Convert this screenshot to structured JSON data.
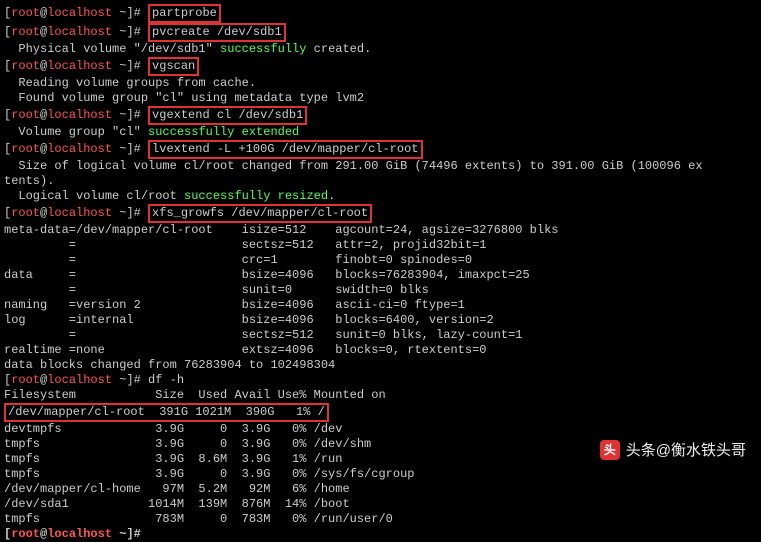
{
  "prompt": {
    "user": "root",
    "at": "@",
    "host": "localhost",
    "path": " ~",
    "hash": "]# "
  },
  "cmds": {
    "partprobe": "partprobe",
    "pvcreate": "pvcreate /dev/sdb1",
    "vgscan": "vgscan",
    "vgextend": "vgextend cl /dev/sdb1",
    "lvextend": "lvextend -L +100G /dev/mapper/cl-root",
    "xfs": "xfs_growfs /dev/mapper/cl-root",
    "dfh": "df -h"
  },
  "out": {
    "pv1": "  Physical volume \"/dev/sdb1\" ",
    "pv1_ok": "successfully",
    "pv1_end": " created.",
    "vgscan1": "  Reading volume groups from cache.",
    "vgscan2": "  Found volume group \"cl\" using metadata type lvm2",
    "vgext1a": "  Volume group \"cl\" ",
    "vgext1b": "successfully extended",
    "lvext1": "  Size of logical volume cl/root changed from 291.00 GiB (74496 extents) to 391.00 GiB (100096 ex",
    "lvext1b": "tents).",
    "lvext2a": "  Logical volume cl/root ",
    "lvext2b": "successfully resized",
    "lvext2c": ".",
    "xfs1": "meta-data=/dev/mapper/cl-root    isize=512    agcount=24, agsize=3276800 blks",
    "xfs2": "         =                       sectsz=512   attr=2, projid32bit=1",
    "xfs3": "         =                       crc=1        finobt=0 spinodes=0",
    "xfs4": "data     =                       bsize=4096   blocks=76283904, imaxpct=25",
    "xfs5": "         =                       sunit=0      swidth=0 blks",
    "xfs6": "naming   =version 2              bsize=4096   ascii-ci=0 ftype=1",
    "xfs7": "log      =internal               bsize=4096   blocks=6400, version=2",
    "xfs8": "         =                       sectsz=512   sunit=0 blks, lazy-count=1",
    "xfs9": "realtime =none                   extsz=4096   blocks=0, rtextents=0",
    "xfs10": "data blocks changed from 76283904 to 102498304",
    "dfh_hdr": "Filesystem           Size  Used Avail Use% Mounted on",
    "dfh_row_hl": "/dev/mapper/cl-root  391G 1021M  390G   1% /",
    "dfh_r2": "devtmpfs             3.9G     0  3.9G   0% /dev",
    "dfh_r3": "tmpfs                3.9G     0  3.9G   0% /dev/shm",
    "dfh_r4": "tmpfs                3.9G  8.6M  3.9G   1% /run",
    "dfh_r5": "tmpfs                3.9G     0  3.9G   0% /sys/fs/cgroup",
    "dfh_r6": "/dev/mapper/cl-home   97M  5.2M   92M   6% /home",
    "dfh_r7": "/dev/sda1           1014M  139M  876M  14% /boot",
    "dfh_r8": "tmpfs                783M     0  783M   0% /run/user/0"
  },
  "watermark": {
    "icon": "头",
    "text": "头条@衡水铁头哥"
  },
  "chart_data": {
    "type": "table",
    "title": "df -h output",
    "columns": [
      "Filesystem",
      "Size",
      "Used",
      "Avail",
      "Use%",
      "Mounted on"
    ],
    "rows": [
      [
        "/dev/mapper/cl-root",
        "391G",
        "1021M",
        "390G",
        "1%",
        "/"
      ],
      [
        "devtmpfs",
        "3.9G",
        "0",
        "3.9G",
        "0%",
        "/dev"
      ],
      [
        "tmpfs",
        "3.9G",
        "0",
        "3.9G",
        "0%",
        "/dev/shm"
      ],
      [
        "tmpfs",
        "3.9G",
        "8.6M",
        "3.9G",
        "1%",
        "/run"
      ],
      [
        "tmpfs",
        "3.9G",
        "0",
        "3.9G",
        "0%",
        "/sys/fs/cgroup"
      ],
      [
        "/dev/mapper/cl-home",
        "97M",
        "5.2M",
        "92M",
        "6%",
        "/home"
      ],
      [
        "/dev/sda1",
        "1014M",
        "139M",
        "876M",
        "14%",
        "/boot"
      ],
      [
        "tmpfs",
        "783M",
        "0",
        "783M",
        "0%",
        "/run/user/0"
      ]
    ]
  }
}
